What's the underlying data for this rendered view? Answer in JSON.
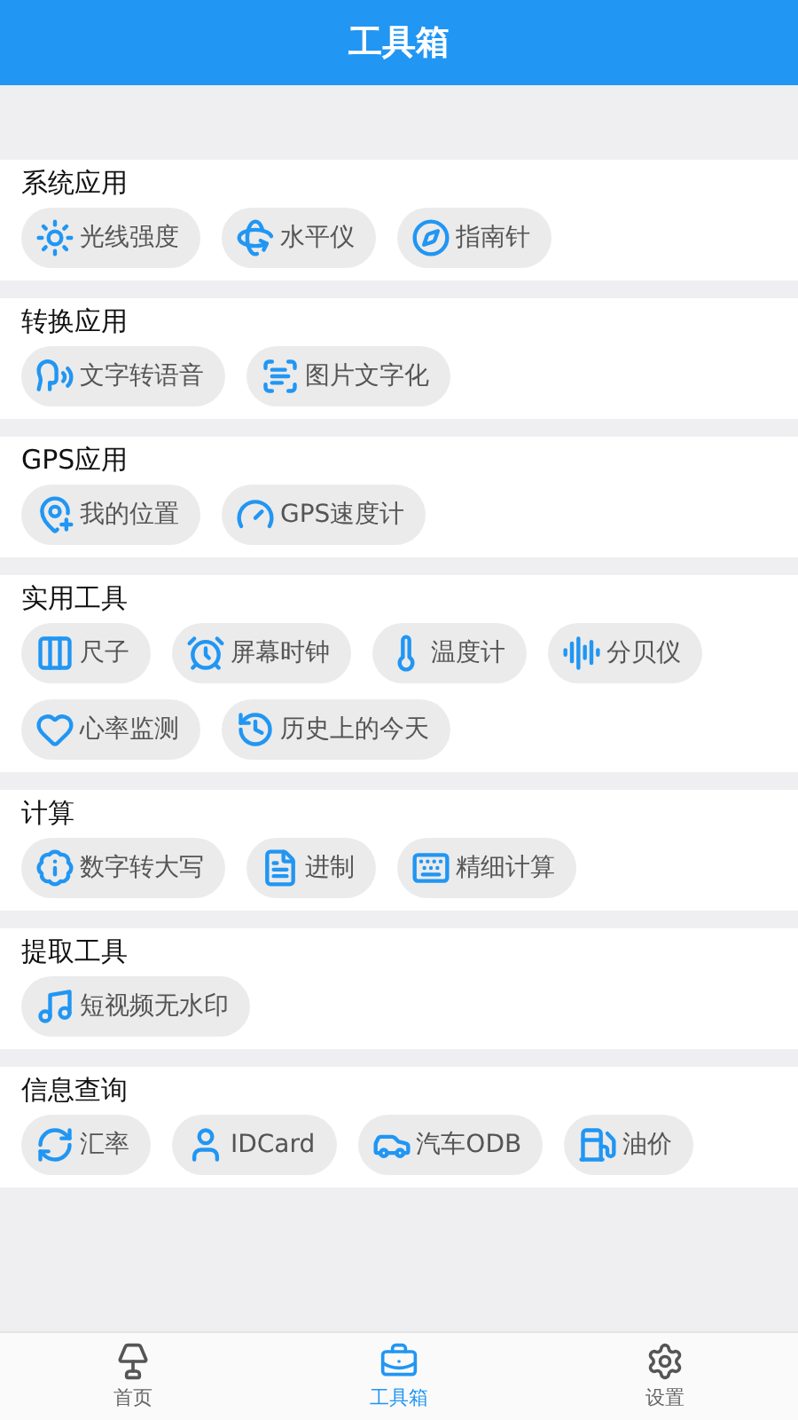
{
  "header": {
    "title": "工具箱"
  },
  "sections": [
    {
      "title": "系统应用",
      "tools": [
        "光线强度",
        "水平仪",
        "指南针"
      ]
    },
    {
      "title": "转换应用",
      "tools": [
        "文字转语音",
        "图片文字化"
      ]
    },
    {
      "title": "GPS应用",
      "tools": [
        "我的位置",
        "GPS速度计"
      ]
    },
    {
      "title": "实用工具",
      "tools": [
        "尺子",
        "屏幕时钟",
        "温度计",
        "分贝仪",
        "心率监测",
        "历史上的今天"
      ]
    },
    {
      "title": "计算",
      "tools": [
        "数字转大写",
        "进制",
        "精细计算"
      ]
    },
    {
      "title": "提取工具",
      "tools": [
        "短视频无水印"
      ]
    },
    {
      "title": "信息查询",
      "tools": [
        "汇率",
        "IDCard",
        "汽车ODB",
        "油价"
      ]
    }
  ],
  "tabbar": [
    {
      "label": "首页",
      "selected": false
    },
    {
      "label": "工具箱",
      "selected": true
    },
    {
      "label": "设置",
      "selected": false
    }
  ]
}
